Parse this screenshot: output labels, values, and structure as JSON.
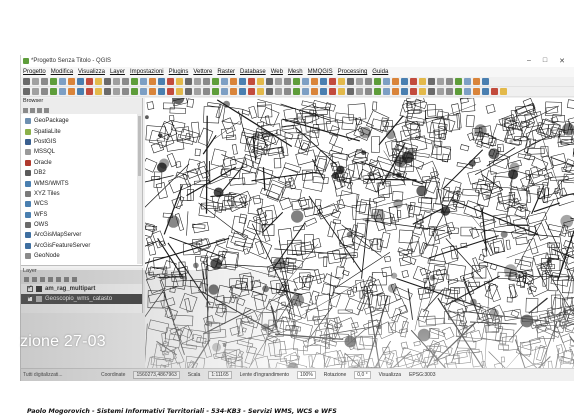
{
  "window": {
    "title": "*Progetto Senza Titolo - QGIS",
    "controls": [
      "–",
      "□",
      "✕"
    ]
  },
  "menu": [
    "Progetto",
    "Modifica",
    "Visualizza",
    "Layer",
    "Impostazioni",
    "Plugins",
    "Vettore",
    "Raster",
    "Database",
    "Web",
    "Mesh",
    "MMQGIS",
    "Processing",
    "Guida"
  ],
  "browser": {
    "title": "Browser",
    "items": [
      {
        "label": "GeoPackage",
        "icon": "geopackage-icon",
        "color": "#6d8fb0"
      },
      {
        "label": "SpatiaLite",
        "icon": "spatialite-icon",
        "color": "#8bb04a"
      },
      {
        "label": "PostGIS",
        "icon": "postgis-icon",
        "color": "#3a5f8f"
      },
      {
        "label": "MSSQL",
        "icon": "mssql-icon",
        "color": "#9a9a9a"
      },
      {
        "label": "Oracle",
        "icon": "oracle-icon",
        "color": "#b03a2e"
      },
      {
        "label": "DB2",
        "icon": "db2-icon",
        "color": "#5a5a5a"
      },
      {
        "label": "WMS/WMTS",
        "icon": "wms-icon",
        "color": "#4a7fb0"
      },
      {
        "label": "XYZ Tiles",
        "icon": "xyz-tiles-icon",
        "color": "#7a7a7a"
      },
      {
        "label": "WCS",
        "icon": "wcs-icon",
        "color": "#4a7fb0"
      },
      {
        "label": "WFS",
        "icon": "wfs-icon",
        "color": "#4a7fb0"
      },
      {
        "label": "OWS",
        "icon": "ows-icon",
        "color": "#6a6a6a"
      },
      {
        "label": "ArcGisMapServer",
        "icon": "arcgis-map-icon",
        "color": "#3f6fa0"
      },
      {
        "label": "ArcGisFeatureServer",
        "icon": "arcgis-feature-icon",
        "color": "#3f6fa0"
      },
      {
        "label": "GeoNode",
        "icon": "geonode-icon",
        "color": "#8a8a8a"
      }
    ]
  },
  "layers": {
    "title": "Layer",
    "items": [
      {
        "label": "am_rag_multipart",
        "selected": false,
        "swatch": "#222222"
      },
      {
        "label": "Geoscopio_wms_catasto",
        "selected": true,
        "swatch": "#b8b8b8"
      }
    ]
  },
  "statusbar": {
    "hint": "Tutti digitalizzati...",
    "coord_label": "Coordinate",
    "coord_value": "1560273,4867963",
    "scale_label": "Scala",
    "scale_value": "1:11165",
    "magnifier_label": "Lente d'ingrandimento",
    "magnifier_value": "100%",
    "rotation_label": "Rotazione",
    "rotation_value": "0,0 °",
    "render_label": "Visualizza",
    "crs": "EPSG:3003"
  },
  "slide": {
    "section_title": "zione 27-03",
    "footer": "Paolo Mogorovich - Sistemi Informativi Territoriali - 534-KB3 - Servizi WMS, WCS e WFS"
  },
  "colors": {
    "map_lines": "#1a1a1a",
    "selection": "#3c3c3c",
    "qgis_green": "#5e9d3a"
  }
}
